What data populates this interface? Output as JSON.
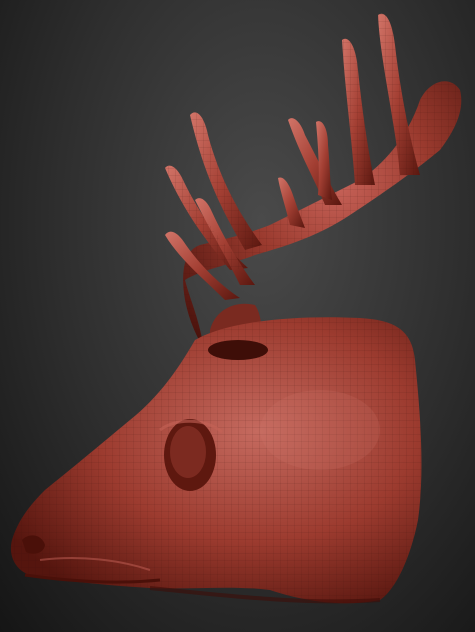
{
  "viewport": {
    "background_color": "#2b2b2b",
    "model": {
      "subject": "moose-head-sculpt",
      "material_color": "#9a3a2e",
      "highlight_color": "#c9645a",
      "shadow_color": "#4a120c",
      "wireframe_visible": true
    }
  }
}
